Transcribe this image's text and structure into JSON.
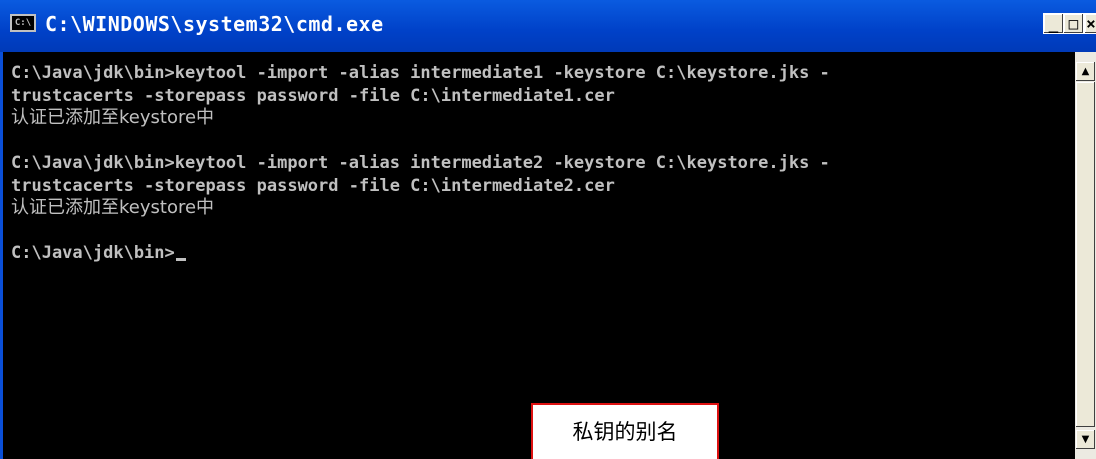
{
  "window": {
    "title": "C:\\WINDOWS\\system32\\cmd.exe",
    "icon_label": "C:\\",
    "buttons": {
      "minimize": "_",
      "maximize": "□",
      "close": "×"
    }
  },
  "console": {
    "lines": [
      "C:\\Java\\jdk\\bin>keytool -import -alias intermediate1 -keystore C:\\keystore.jks -",
      "trustcacerts -storepass password -file C:\\intermediate1.cer",
      "认证已添加至keystore中",
      "",
      "C:\\Java\\jdk\\bin>keytool -import -alias intermediate2 -keystore C:\\keystore.jks -",
      "trustcacerts -storepass password -file C:\\intermediate2.cer",
      "认证已添加至keystore中",
      "",
      "C:\\Java\\jdk\\bin>"
    ]
  },
  "scrollbar": {
    "up": "▲",
    "down": "▼"
  },
  "annotation": {
    "text": "私钥的别名",
    "border_color": "#dd1111"
  }
}
